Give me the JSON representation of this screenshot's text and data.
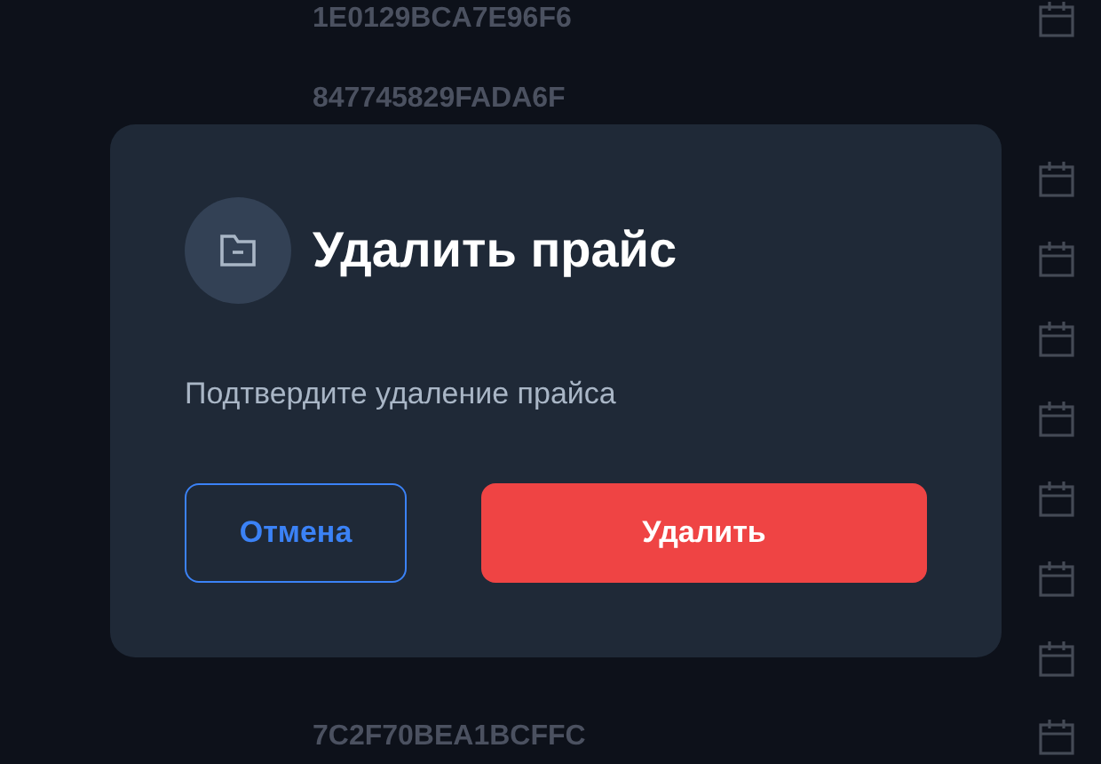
{
  "background_list": [
    {
      "code": "1E0129BCA7E96F6",
      "calendar": true
    },
    {
      "code": "847745829FADA6F",
      "calendar": false
    },
    {
      "calendar": true
    },
    {
      "calendar": true
    },
    {
      "calendar": true
    },
    {
      "calendar": true
    },
    {
      "calendar": true
    },
    {
      "calendar": true
    },
    {
      "calendar": true
    },
    {
      "code": "7C2F70BEA1BCFFC",
      "calendar": true
    }
  ],
  "dialog": {
    "title": "Удалить прайс",
    "message": "Подтвердите удаление прайса",
    "buttons": [
      {
        "label": "Отмена",
        "kind": "secondary"
      },
      {
        "label": "Удалить",
        "kind": "danger"
      }
    ]
  }
}
